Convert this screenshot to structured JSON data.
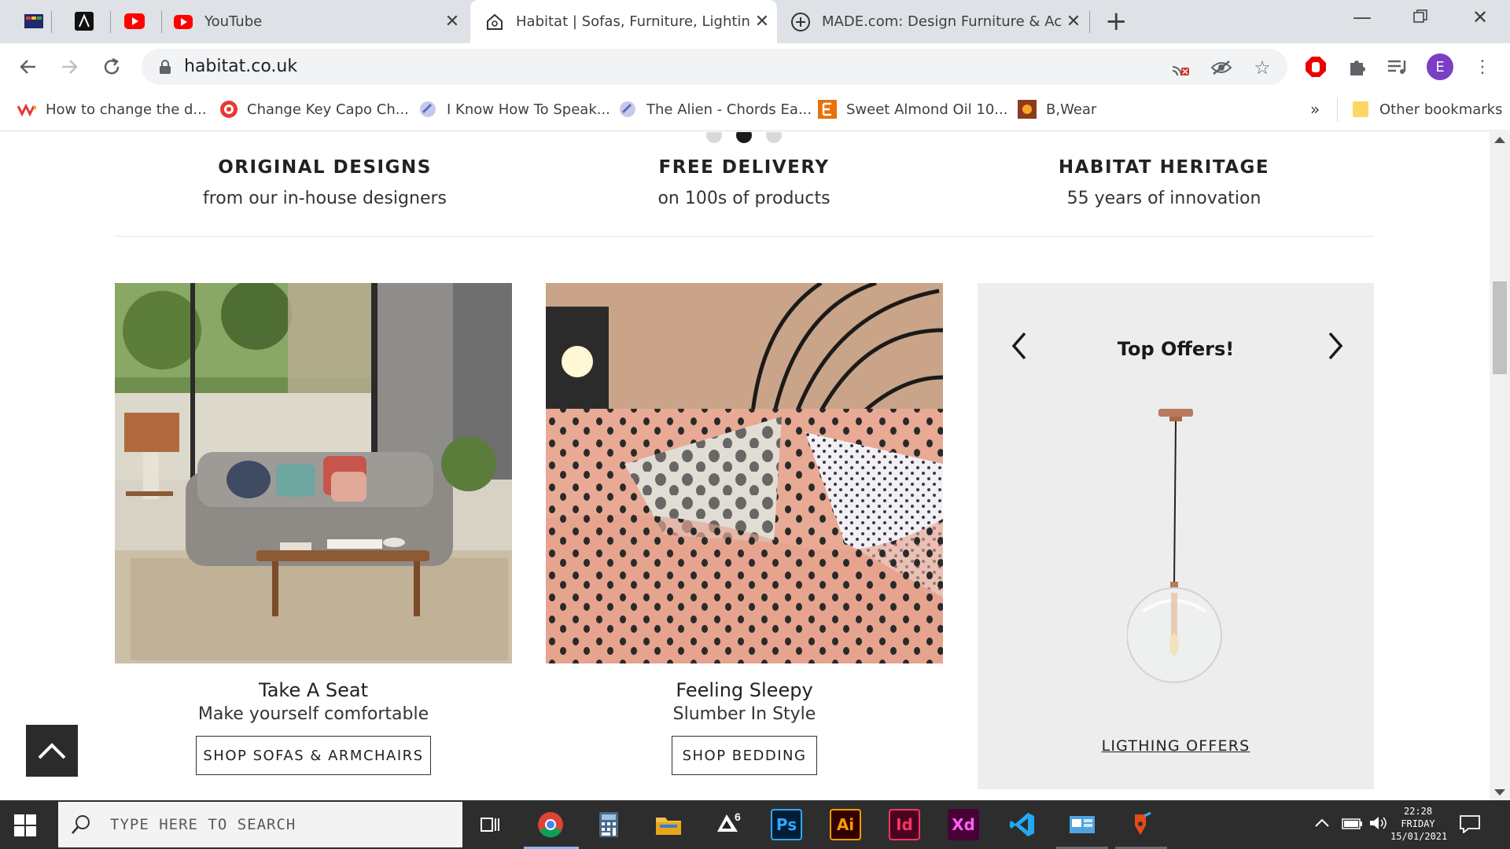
{
  "browser": {
    "tabs": [
      {
        "title": "YouTube"
      },
      {
        "title": "Habitat | Sofas, Furniture, Lighting, H"
      },
      {
        "title": "MADE.com: Design Furniture & Acce"
      }
    ],
    "url": "habitat.co.uk",
    "profile_initial": "E",
    "bookmarks": [
      {
        "label": "How to change the d..."
      },
      {
        "label": "Change Key Capo Ch..."
      },
      {
        "label": "I Know How To Speak..."
      },
      {
        "label": "The Alien - Chords Ea..."
      },
      {
        "label": "Sweet Almond Oil 10..."
      },
      {
        "label": "B,Wear"
      }
    ],
    "bookmarks_overflow": "»",
    "other_bookmarks": "Other bookmarks"
  },
  "page": {
    "usps": [
      {
        "heading": "ORIGINAL DESIGNS",
        "sub": "from our in-house designers"
      },
      {
        "heading": "FREE DELIVERY",
        "sub": "on 100s of products"
      },
      {
        "heading": "HABITAT HERITAGE",
        "sub": "55 years of innovation"
      }
    ],
    "cards": [
      {
        "title": "Take A Seat",
        "subtitle": "Make yourself comfortable",
        "button": "SHOP SOFAS & ARMCHAIRS"
      },
      {
        "title": "Feeling Sleepy",
        "subtitle": "Slumber In Style",
        "button": "SHOP BEDDING"
      }
    ],
    "offers": {
      "title": "Top Offers!",
      "link": "LIGTHING OFFERS"
    },
    "carousel_dots_active": 2
  },
  "taskbar": {
    "search_placeholder": "TYPE HERE TO SEARCH",
    "clock_time": "22:28",
    "clock_day": "FRIDAY",
    "clock_date": "15/01/2021"
  },
  "colors": {
    "accent_profile": "#7b3fc4",
    "taskbar": "#2d2d2d",
    "offers_bg": "#ededed"
  }
}
